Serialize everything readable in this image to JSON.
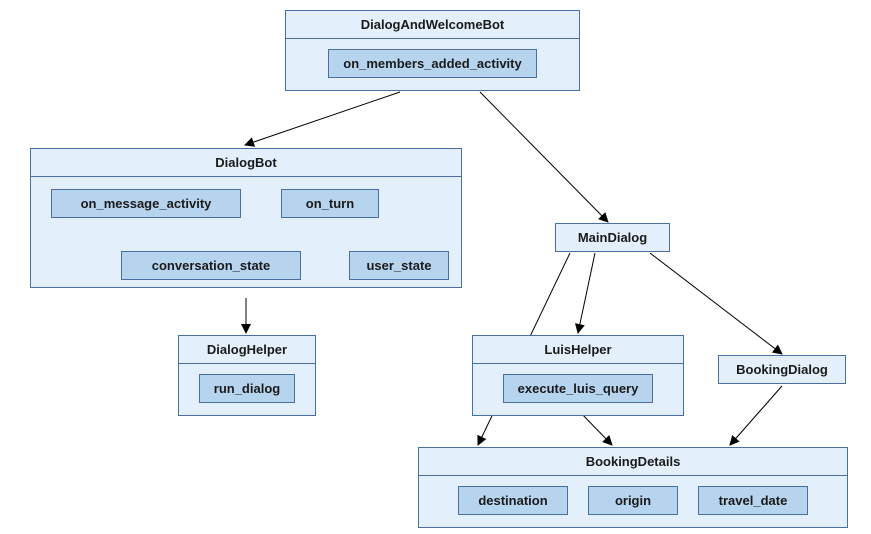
{
  "nodes": {
    "dialogAndWelcomeBot": {
      "title": "DialogAndWelcomeBot",
      "members": [
        "on_members_added_activity"
      ]
    },
    "dialogBot": {
      "title": "DialogBot",
      "members": [
        "on_message_activity",
        "on_turn",
        "conversation_state",
        "user_state"
      ]
    },
    "mainDialog": {
      "title": "MainDialog"
    },
    "dialogHelper": {
      "title": "DialogHelper",
      "members": [
        "run_dialog"
      ]
    },
    "luisHelper": {
      "title": "LuisHelper",
      "members": [
        "execute_luis_query"
      ]
    },
    "bookingDialog": {
      "title": "BookingDialog"
    },
    "bookingDetails": {
      "title": "BookingDetails",
      "members": [
        "destination",
        "origin",
        "travel_date"
      ]
    }
  },
  "edges": [
    {
      "from": "dialogAndWelcomeBot",
      "to": "dialogBot"
    },
    {
      "from": "dialogAndWelcomeBot",
      "to": "mainDialog"
    },
    {
      "from": "dialogBot.on_turn",
      "to": "dialogBot.conversation_state"
    },
    {
      "from": "dialogBot.on_turn",
      "to": "dialogBot.user_state"
    },
    {
      "from": "dialogBot",
      "to": "dialogHelper"
    },
    {
      "from": "mainDialog",
      "to": "luisHelper"
    },
    {
      "from": "mainDialog",
      "to": "bookingDialog"
    },
    {
      "from": "mainDialog",
      "to": "bookingDetails"
    },
    {
      "from": "luisHelper",
      "to": "bookingDetails"
    },
    {
      "from": "bookingDialog",
      "to": "bookingDetails"
    }
  ]
}
